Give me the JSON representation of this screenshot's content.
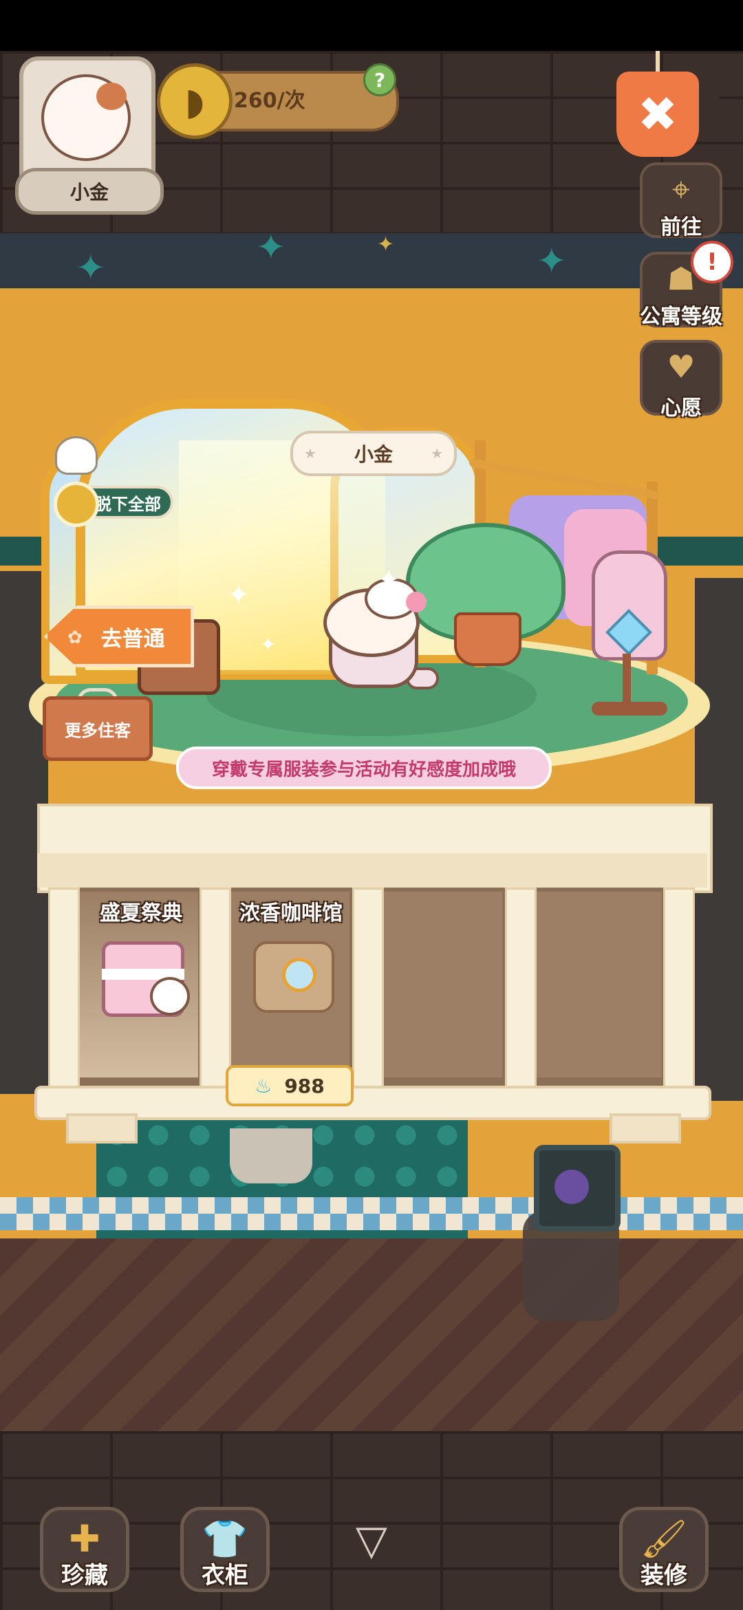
{
  "header": {
    "character_name": "小金",
    "currency_rate": "260/次",
    "help_symbol": "?",
    "close_symbol": "✖"
  },
  "side_menu": [
    {
      "label": "前往",
      "icon": "location-pin-icon"
    },
    {
      "label": "公寓等级",
      "icon": "apartment-level-icon"
    },
    {
      "label": "心愿",
      "icon": "wish-book-icon"
    }
  ],
  "alert_symbol": "!",
  "stage": {
    "name_badge": "小金",
    "undress_all": "脱下全部",
    "go_normal": "去普通",
    "more_guests": "更多住客",
    "tip": "穿戴专属服装参与活动有好感度加成哦"
  },
  "cabinet": {
    "slots": [
      {
        "title": "盛夏祭典"
      },
      {
        "title": "浓香咖啡馆"
      },
      {
        "title": ""
      },
      {
        "title": ""
      }
    ],
    "price": "988"
  },
  "bottom_nav": [
    {
      "label": "珍藏",
      "icon": "collection-icon"
    },
    {
      "label": "衣柜",
      "icon": "wardrobe-icon"
    },
    {
      "label": "装修",
      "icon": "paint-brush-icon"
    }
  ],
  "colors": {
    "accent_orange": "#f08a3a",
    "tip_pink": "#c23b6c",
    "room_yellow": "#e3a23a"
  }
}
